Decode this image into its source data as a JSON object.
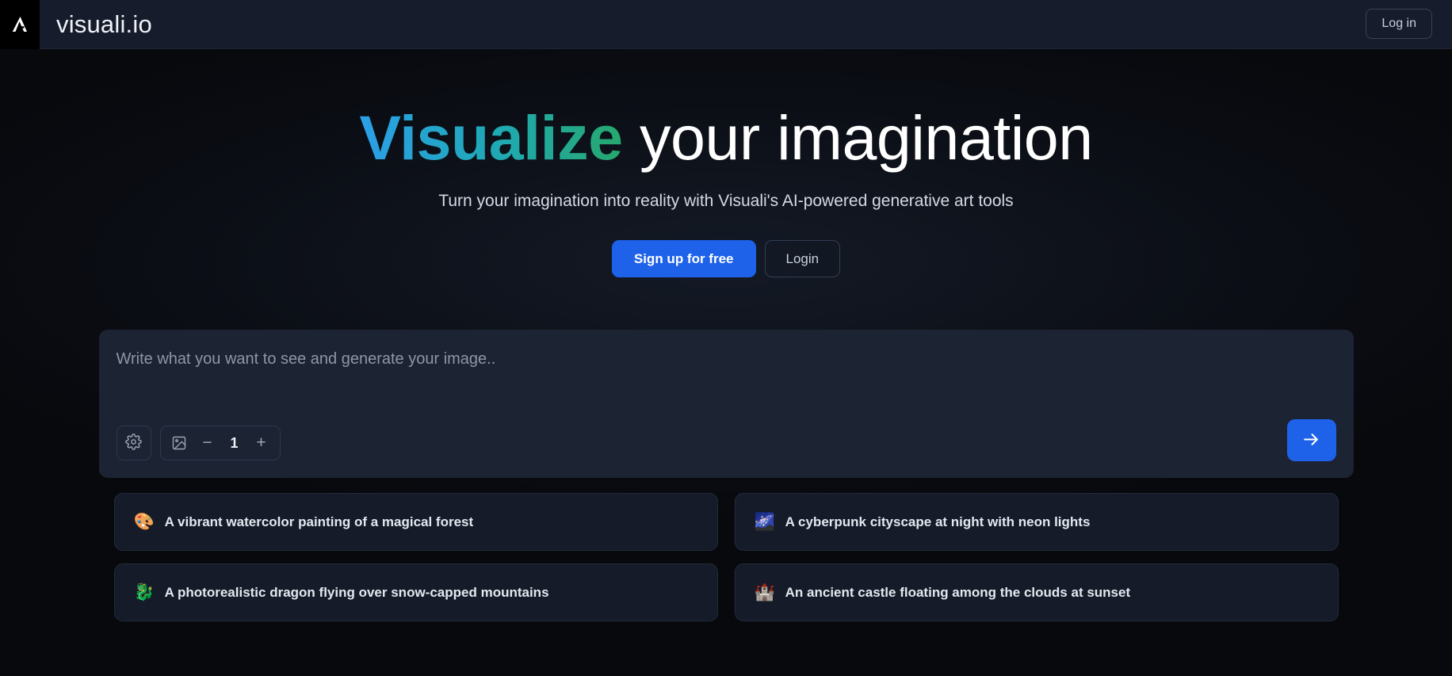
{
  "navbar": {
    "logo_icon": "visuali-lambda-logo-icon",
    "brand_name": "visuali.io",
    "login_label": "Log in"
  },
  "hero": {
    "title_highlight": "Visualize",
    "title_rest": " your imagination",
    "subtitle": "Turn your imagination into reality with Visuali's AI-powered generative art tools",
    "signup_label": "Sign up for free",
    "login_label": "Login",
    "gradient_start": "#2b9fe8",
    "gradient_mid": "#1fa9b4",
    "gradient_end": "#26a86d"
  },
  "composer": {
    "placeholder": "Write what you want to see and generate your image..",
    "value": "",
    "settings_icon": "gear-icon",
    "image_icon": "image-icon",
    "decrement_label": "−",
    "count": "1",
    "increment_label": "+",
    "submit_icon": "arrow-right-icon",
    "accent_color": "#1f62ea"
  },
  "suggestions": [
    {
      "emoji": "🎨",
      "icon_name": "palette-emoji-icon",
      "text": "A vibrant watercolor painting of a magical forest"
    },
    {
      "emoji": "🌌",
      "icon_name": "milky-way-emoji-icon",
      "text": "A cyberpunk cityscape at night with neon lights"
    },
    {
      "emoji": "🐉",
      "icon_name": "dragon-emoji-icon",
      "text": "A photorealistic dragon flying over snow-capped mountains"
    },
    {
      "emoji": "🏰",
      "icon_name": "castle-emoji-icon",
      "text": "An ancient castle floating among the clouds at sunset"
    }
  ]
}
